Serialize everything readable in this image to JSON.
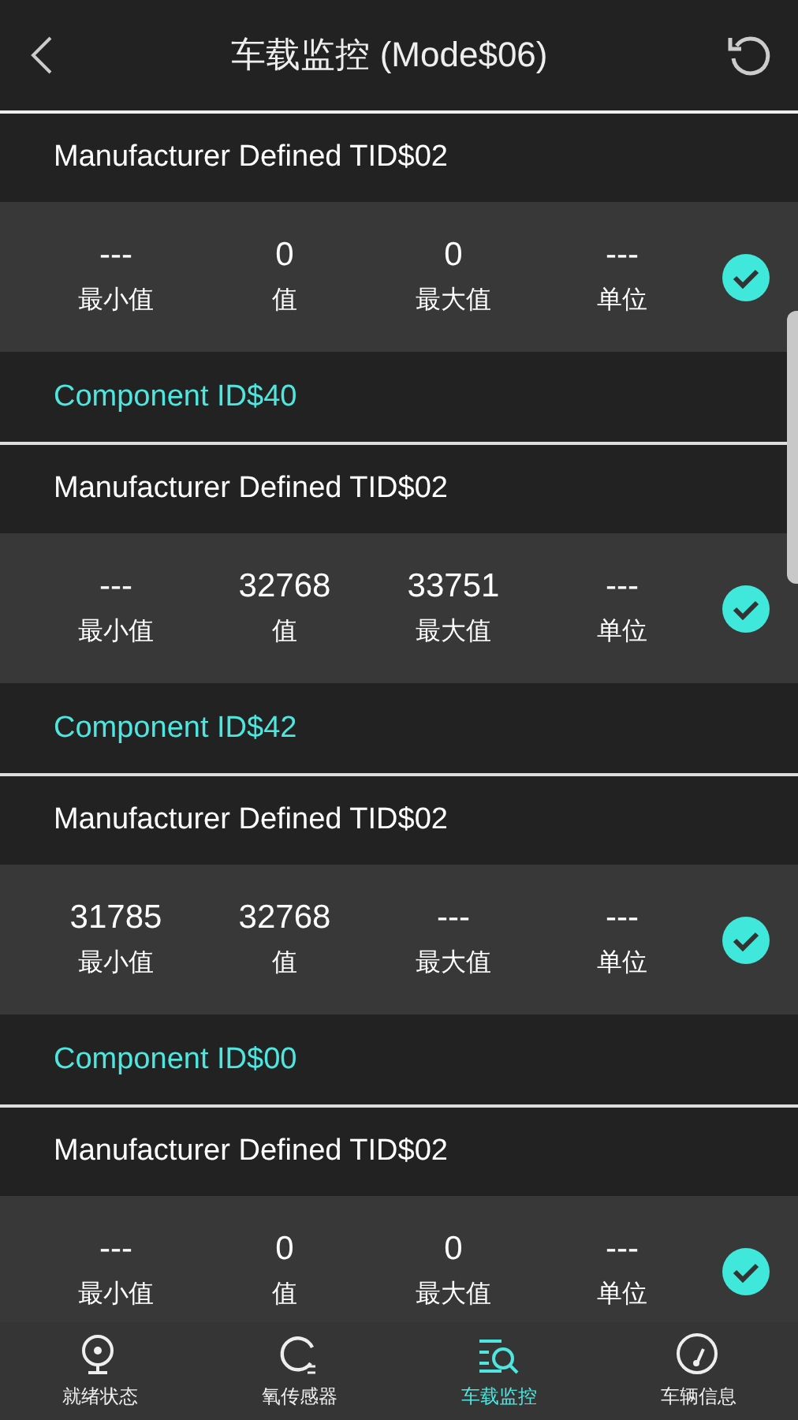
{
  "header": {
    "title": "车载监控 (Mode$06)"
  },
  "tests": [
    {
      "title": "Manufacturer Defined TID$02",
      "values": [
        {
          "value": "---",
          "label": "最小值"
        },
        {
          "value": "0",
          "label": "值"
        },
        {
          "value": "0",
          "label": "最大值"
        },
        {
          "value": "---",
          "label": "单位"
        }
      ],
      "checked": true,
      "component": "Component ID$40"
    },
    {
      "title": "Manufacturer Defined TID$02",
      "values": [
        {
          "value": "---",
          "label": "最小值"
        },
        {
          "value": "32768",
          "label": "值"
        },
        {
          "value": "33751",
          "label": "最大值"
        },
        {
          "value": "---",
          "label": "单位"
        }
      ],
      "checked": true,
      "component": "Component ID$42"
    },
    {
      "title": "Manufacturer Defined TID$02",
      "values": [
        {
          "value": "31785",
          "label": "最小值"
        },
        {
          "value": "32768",
          "label": "值"
        },
        {
          "value": "---",
          "label": "最大值"
        },
        {
          "value": "---",
          "label": "单位"
        }
      ],
      "checked": true,
      "component": "Component ID$00"
    },
    {
      "title": "Manufacturer Defined TID$02",
      "values": [
        {
          "value": "---",
          "label": "最小值"
        },
        {
          "value": "0",
          "label": "值"
        },
        {
          "value": "0",
          "label": "最大值"
        },
        {
          "value": "---",
          "label": "单位"
        }
      ],
      "checked": true
    }
  ],
  "nav": [
    {
      "label": "就绪状态",
      "selected": false
    },
    {
      "label": "氧传感器",
      "selected": false
    },
    {
      "label": "车载监控",
      "selected": true
    },
    {
      "label": "车辆信息",
      "selected": false
    }
  ]
}
